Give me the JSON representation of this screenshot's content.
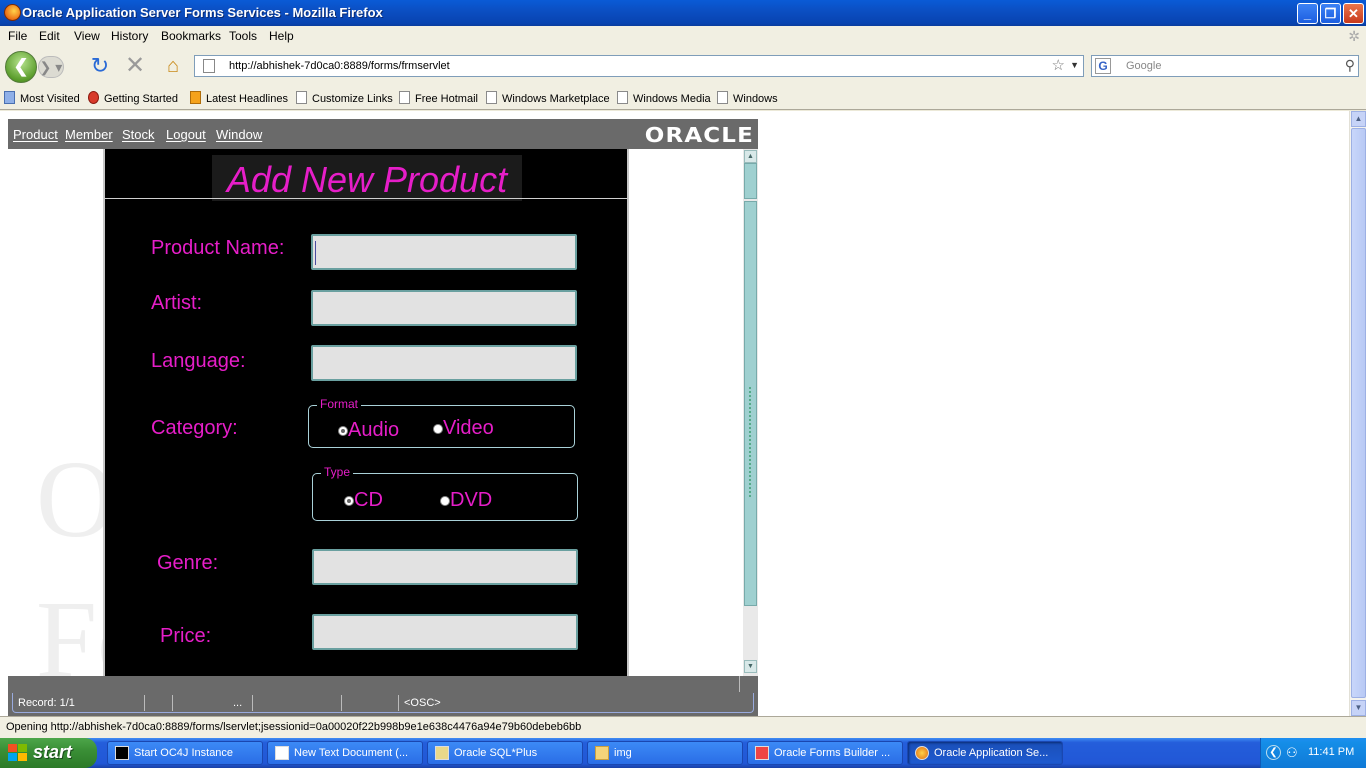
{
  "window": {
    "title": "Oracle Application Server Forms Services - Mozilla Firefox",
    "controls": {
      "minimize": "_",
      "restore": "❐",
      "close": "✕"
    }
  },
  "menubar": [
    "File",
    "Edit",
    "View",
    "History",
    "Bookmarks",
    "Tools",
    "Help"
  ],
  "navbar": {
    "url": "http://abhishek-7d0ca0:8889/forms/frmservlet",
    "search_placeholder": "Google"
  },
  "bookmarks": [
    "Most Visited",
    "Getting Started",
    "Latest Headlines",
    "Customize Links",
    "Free Hotmail",
    "Windows Marketplace",
    "Windows Media",
    "Windows"
  ],
  "app": {
    "menu": [
      "Product",
      "Member",
      "Stock",
      "Logout",
      "Window"
    ],
    "logo": "ORACLE",
    "watermark": [
      "Ora",
      "For"
    ],
    "heading": "Add New Product",
    "fields": {
      "product_name": {
        "label": "Product Name:",
        "value": ""
      },
      "artist": {
        "label": "Artist:",
        "value": ""
      },
      "language": {
        "label": "Language:",
        "value": ""
      },
      "category": {
        "label": "Category:"
      },
      "genre": {
        "label": "Genre:",
        "value": ""
      },
      "price": {
        "label": "Price:",
        "value": ""
      }
    },
    "format_group": {
      "legend": "Format",
      "options": [
        "Audio",
        "Video"
      ],
      "selected": "Audio"
    },
    "type_group": {
      "legend": "Type",
      "options": [
        "CD",
        "DVD"
      ],
      "selected": "CD"
    },
    "status": {
      "record": "Record: 1/1",
      "ellipsis": "...",
      "osc": "<OSC>"
    }
  },
  "statusbar": "Opening http://abhishek-7d0ca0:8889/forms/lservlet;jsessionid=0a00020f22b998b9e1e638c4476a94e79b60debeb6bb",
  "taskbar": {
    "start": "start",
    "tasks": [
      "Start OC4J Instance",
      "New Text Document (...",
      "Oracle SQL*Plus",
      "img",
      "Oracle Forms Builder ...",
      "Oracle Application Se..."
    ],
    "clock": "11:41 PM"
  }
}
